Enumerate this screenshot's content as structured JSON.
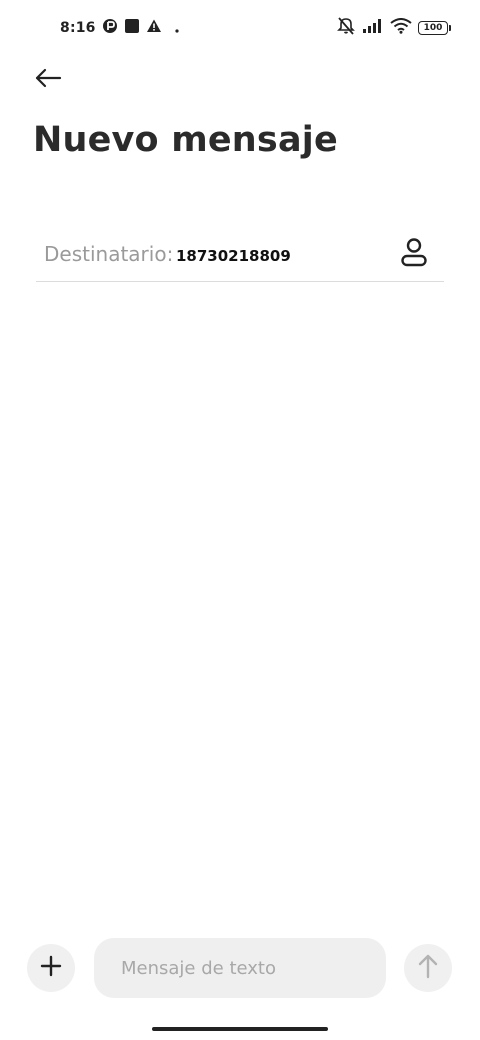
{
  "status_bar": {
    "time": "8:16",
    "battery": "100",
    "icons": [
      "app-icon",
      "square-icon",
      "warning-icon",
      "dot-icon",
      "mute-icon",
      "signal-icon",
      "wifi-icon",
      "battery-icon"
    ]
  },
  "header": {
    "back_icon": "arrow-left-icon",
    "title": "Nuevo mensaje"
  },
  "recipient": {
    "label": "Destinatario:",
    "value": "18730218809",
    "contact_icon": "person-icon"
  },
  "composer": {
    "add_icon": "plus-icon",
    "placeholder": "Mensaje de texto",
    "value": "",
    "send_icon": "arrow-up-icon"
  },
  "colors": {
    "background": "#ffffff",
    "title": "#2b2b2b",
    "label_gray": "#9a9a9a",
    "field_bg": "#efefef",
    "divider": "#dcdcdc"
  }
}
